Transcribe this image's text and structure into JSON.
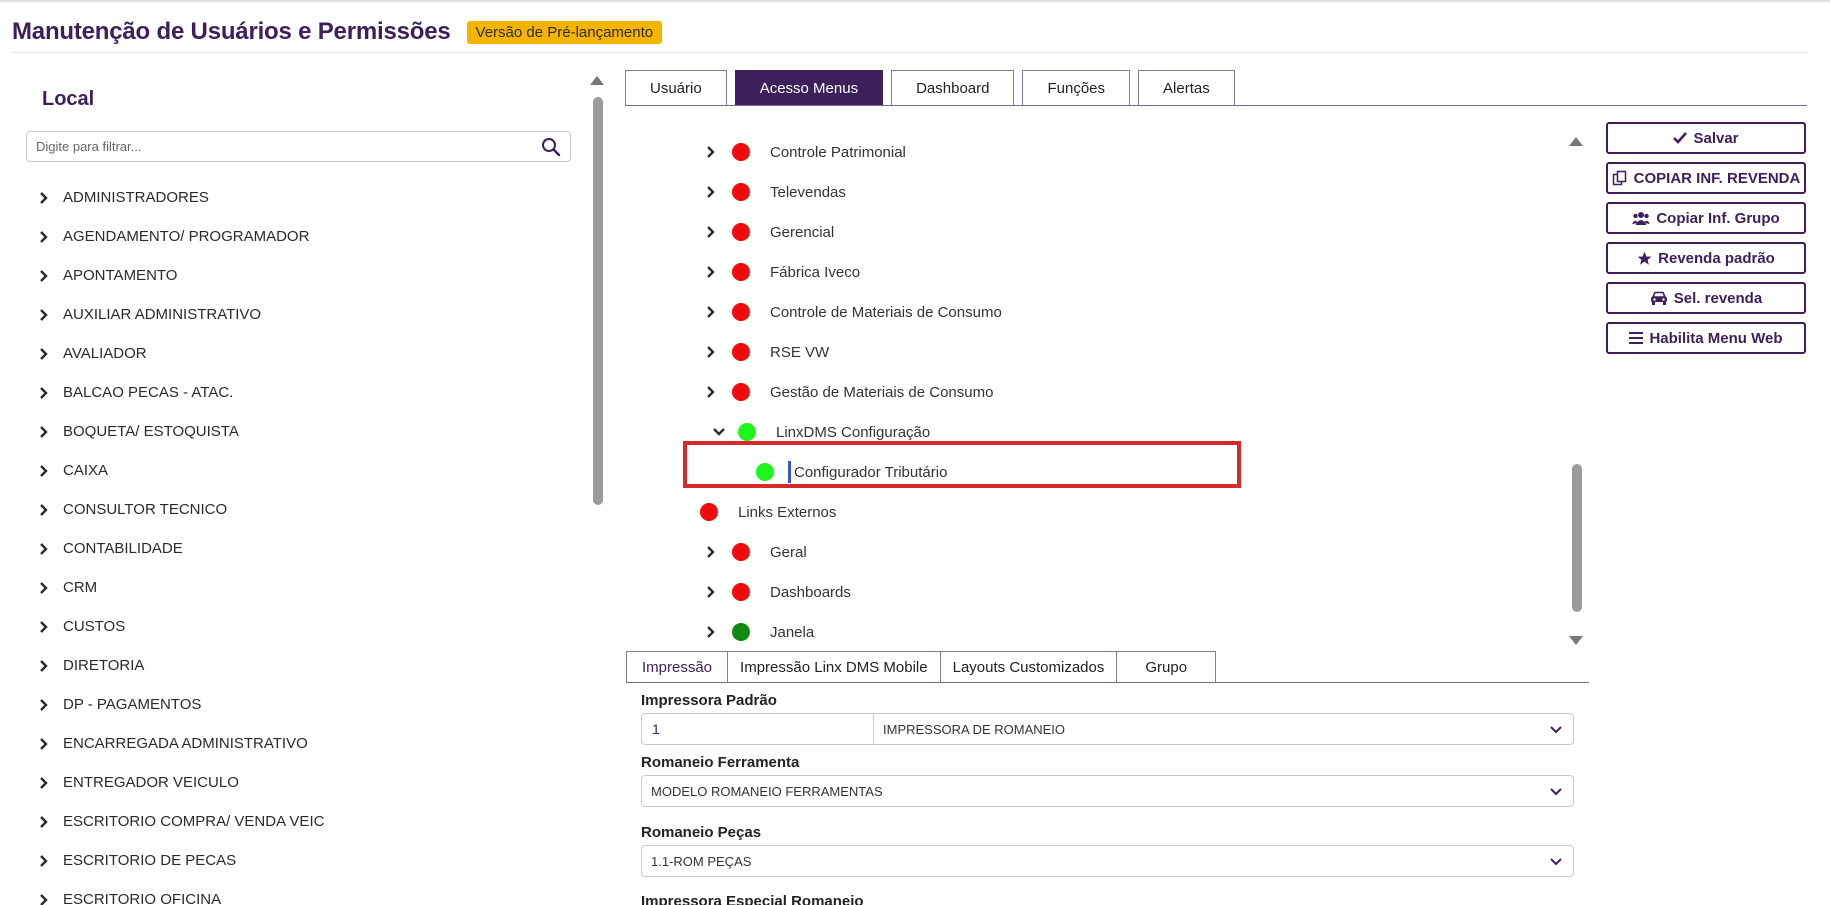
{
  "header": {
    "title": "Manutenção de Usuários e Permissões",
    "badge": "Versão de Pré-lançamento"
  },
  "local": {
    "title": "Local",
    "filter_placeholder": "Digite para filtrar...",
    "items": [
      "ADMINISTRADORES",
      "AGENDAMENTO/ PROGRAMADOR",
      "APONTAMENTO",
      "AUXILIAR ADMINISTRATIVO",
      "AVALIADOR",
      "BALCAO PECAS - ATAC.",
      "BOQUETA/ ESTOQUISTA",
      "CAIXA",
      "CONSULTOR TECNICO",
      "CONTABILIDADE",
      "CRM",
      "CUSTOS",
      "DIRETORIA",
      "DP - PAGAMENTOS",
      "ENCARREGADA ADMINISTRATIVO",
      "ENTREGADOR VEICULO",
      "ESCRITORIO COMPRA/ VENDA VEIC",
      "ESCRITORIO DE PECAS",
      "ESCRITORIO OFICINA"
    ]
  },
  "tabs": [
    "Usuário",
    "Acesso Menus",
    "Dashboard",
    "Funções",
    "Alertas"
  ],
  "tree": {
    "rows": [
      {
        "label": "Controle Patrimonial",
        "status": "red",
        "chevron": "right",
        "indent": 0
      },
      {
        "label": "Televendas",
        "status": "red",
        "chevron": "right",
        "indent": 0
      },
      {
        "label": "Gerencial",
        "status": "red",
        "chevron": "right",
        "indent": 0
      },
      {
        "label": "Fábrica Iveco",
        "status": "red",
        "chevron": "right",
        "indent": 0
      },
      {
        "label": "Controle de Materiais de Consumo",
        "status": "red",
        "chevron": "right",
        "indent": 0
      },
      {
        "label": "RSE VW",
        "status": "red",
        "chevron": "right",
        "indent": 0
      },
      {
        "label": "Gestão de Materiais de Consumo",
        "status": "red",
        "chevron": "right",
        "indent": 0
      },
      {
        "label": "LinxDMS Configuração",
        "status": "lime",
        "chevron": "down",
        "indent": 0
      },
      {
        "label": "Configurador Tributário",
        "status": "lime",
        "chevron": "none",
        "indent": 1
      },
      {
        "label": "Links Externos",
        "status": "red",
        "chevron": "none",
        "indent": -1
      },
      {
        "label": "Geral",
        "status": "red",
        "chevron": "right",
        "indent": 0
      },
      {
        "label": "Dashboards",
        "status": "red",
        "chevron": "right",
        "indent": 0
      },
      {
        "label": "Janela",
        "status": "green",
        "chevron": "right",
        "indent": 0
      }
    ]
  },
  "actions": {
    "save": "Salvar",
    "copy_revenda": "COPIAR INF. REVENDA",
    "copy_grupo": "Copiar Inf. Grupo",
    "revenda_padrao": "Revenda padrão",
    "sel_revenda": "Sel. revenda",
    "habilita_menu": "Habilita Menu Web"
  },
  "subtabs": [
    "Impressão",
    "Impressão Linx DMS Mobile",
    "Layouts Customizados",
    "Grupo"
  ],
  "form": {
    "impressora_padrao": {
      "label": "Impressora Padrão",
      "code": "1",
      "value": "IMPRESSORA DE ROMANEIO"
    },
    "romaneio_ferramenta": {
      "label": "Romaneio Ferramenta",
      "value": "MODELO ROMANEIO FERRAMENTAS"
    },
    "romaneio_pecas": {
      "label": "Romaneio Peças",
      "value": "1.1-ROM PEÇAS"
    },
    "impressora_especial": {
      "label": "Impressora Especial Romaneio"
    }
  },
  "colors": {
    "brand": "#3d1f5c",
    "badge": "#f5b400",
    "status_red": "#f20c0c",
    "status_lime": "#1ef41e",
    "status_green": "#118a11",
    "highlight": "#d52b2b"
  }
}
